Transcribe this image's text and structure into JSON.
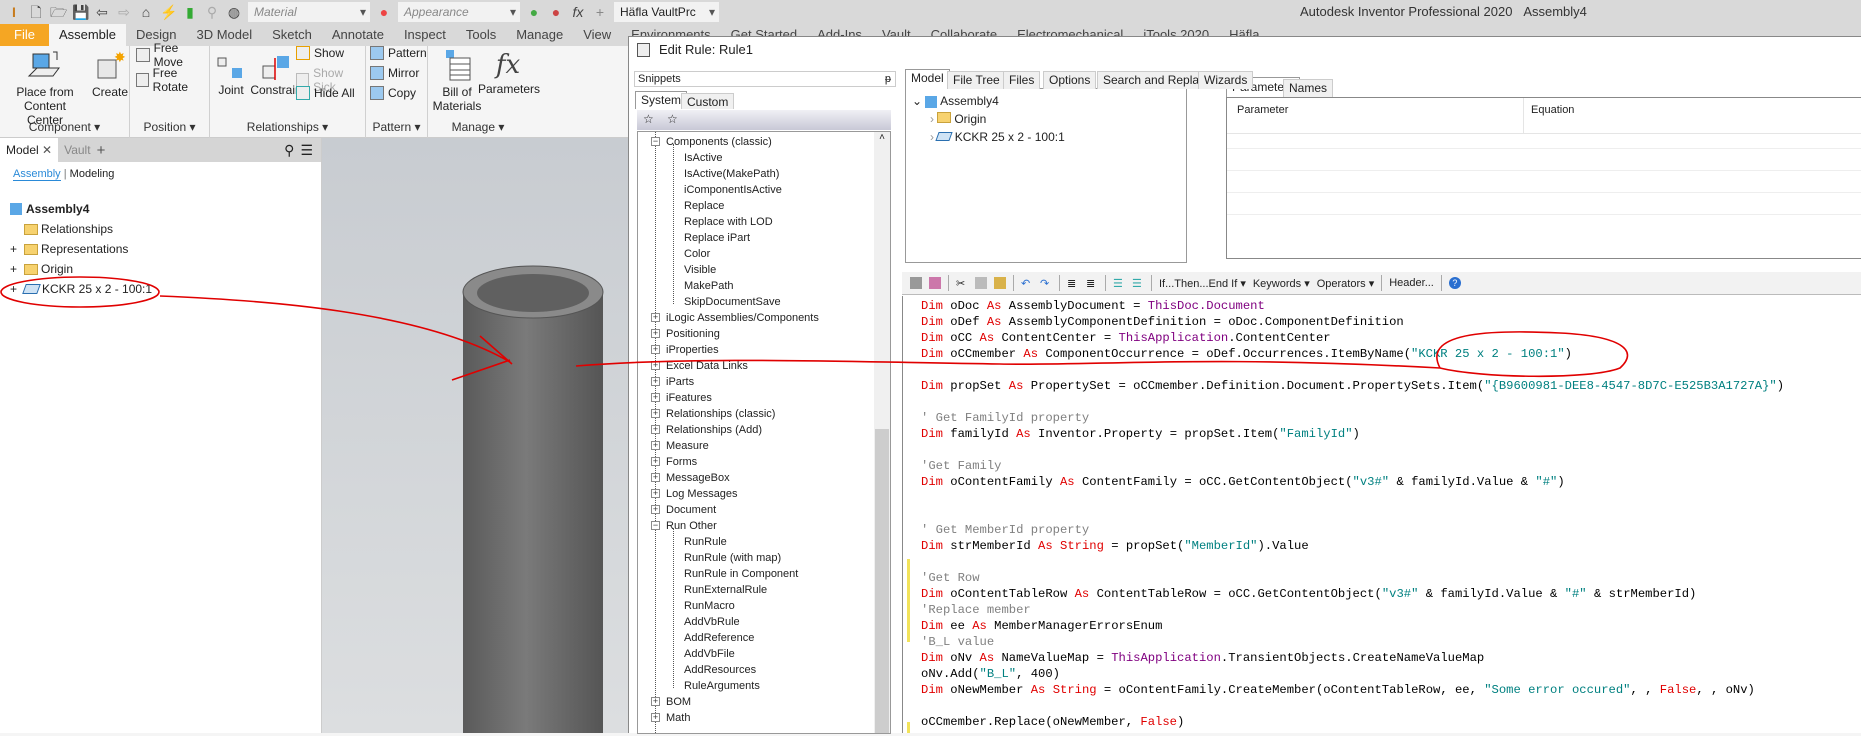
{
  "app": {
    "title": "Autodesk Inventor Professional 2020",
    "document": "Assembly4",
    "logo_text": "PRO"
  },
  "qat": {
    "material": "Material",
    "appearance": "Appearance",
    "vault": "Häfla VaultPrc"
  },
  "ribbon_tabs": [
    "File",
    "Assemble",
    "Design",
    "3D Model",
    "Sketch",
    "Annotate",
    "Inspect",
    "Tools",
    "Manage",
    "View",
    "Environments",
    "Get Started",
    "Add-Ins",
    "Vault",
    "Collaborate",
    "Electromechanical",
    "iTools 2020",
    "Häfla"
  ],
  "ribbon": {
    "component": {
      "label": "Component",
      "place": "Place from\nContent Center",
      "create": "Create"
    },
    "position": {
      "label": "Position",
      "free_move": "Free Move",
      "free_rotate": "Free Rotate"
    },
    "relationships": {
      "label": "Relationships",
      "joint": "Joint",
      "constrain": "Constrain",
      "show": "Show",
      "show_sick": "Show Sick",
      "hide_all": "Hide All"
    },
    "pattern": {
      "label": "Pattern",
      "pattern": "Pattern",
      "mirror": "Mirror",
      "copy": "Copy"
    },
    "manage": {
      "label": "Manage",
      "bom": "Bill of\nMaterials",
      "parameters": "Parameters"
    }
  },
  "browser": {
    "tab_model": "Model",
    "tab_vault": "Vault",
    "view_assembly": "Assembly",
    "view_modeling": "Modeling",
    "root": "Assembly4",
    "items": [
      "Relationships",
      "Representations",
      "Origin",
      "KCKR 25 x 2 - 100:1"
    ]
  },
  "dialog": {
    "title": "Edit Rule: Rule1",
    "snippets": {
      "header": "Snippets",
      "tabs": [
        "System",
        "Custom"
      ],
      "items": [
        {
          "label": "Components (classic)",
          "level": 0,
          "expanded": true
        },
        {
          "label": "IsActive",
          "level": 1
        },
        {
          "label": "IsActive(MakePath)",
          "level": 1
        },
        {
          "label": "iComponentIsActive",
          "level": 1
        },
        {
          "label": "Replace",
          "level": 1
        },
        {
          "label": "Replace with LOD",
          "level": 1
        },
        {
          "label": "Replace iPart",
          "level": 1
        },
        {
          "label": "Color",
          "level": 1
        },
        {
          "label": "Visible",
          "level": 1
        },
        {
          "label": "MakePath",
          "level": 1
        },
        {
          "label": "SkipDocumentSave",
          "level": 1
        },
        {
          "label": "iLogic Assemblies/Components",
          "level": 0
        },
        {
          "label": "Positioning",
          "level": 0
        },
        {
          "label": "iProperties",
          "level": 0
        },
        {
          "label": "Excel Data Links",
          "level": 0
        },
        {
          "label": "iParts",
          "level": 0
        },
        {
          "label": "iFeatures",
          "level": 0
        },
        {
          "label": "Relationships (classic)",
          "level": 0
        },
        {
          "label": "Relationships (Add)",
          "level": 0
        },
        {
          "label": "Measure",
          "level": 0
        },
        {
          "label": "Forms",
          "level": 0
        },
        {
          "label": "MessageBox",
          "level": 0
        },
        {
          "label": "Log Messages",
          "level": 0
        },
        {
          "label": "Document",
          "level": 0
        },
        {
          "label": "Run Other",
          "level": 0,
          "expanded": true
        },
        {
          "label": "RunRule",
          "level": 1
        },
        {
          "label": "RunRule (with map)",
          "level": 1
        },
        {
          "label": "RunRule in Component",
          "level": 1
        },
        {
          "label": "RunExternalRule",
          "level": 1
        },
        {
          "label": "RunMacro",
          "level": 1
        },
        {
          "label": "AddVbRule",
          "level": 1
        },
        {
          "label": "AddReference",
          "level": 1
        },
        {
          "label": "AddVbFile",
          "level": 1
        },
        {
          "label": "AddResources",
          "level": 1
        },
        {
          "label": "RuleArguments",
          "level": 1
        },
        {
          "label": "BOM",
          "level": 0
        },
        {
          "label": "Math",
          "level": 0
        }
      ]
    },
    "tabs": [
      "Model",
      "File Tree",
      "Files",
      "Options",
      "Search and Replace",
      "Wizards"
    ],
    "model_tree": [
      "Assembly4",
      "Origin",
      "KCKR 25 x 2 - 100:1"
    ],
    "param_tabs": [
      "Parameters",
      "Names"
    ],
    "param_columns": [
      "Parameter",
      "Equation"
    ],
    "toolbar": {
      "if_then": "If...Then...End If",
      "keywords": "Keywords",
      "operators": "Operators",
      "header": "Header..."
    },
    "code": [
      [
        [
          "k",
          "Dim"
        ],
        [
          "t",
          " oDoc "
        ],
        [
          "k",
          "As"
        ],
        [
          "t",
          " AssemblyDocument = "
        ],
        [
          "p",
          "ThisDoc.Document"
        ]
      ],
      [
        [
          "k",
          "Dim"
        ],
        [
          "t",
          " oDef "
        ],
        [
          "k",
          "As"
        ],
        [
          "t",
          " AssemblyComponentDefinition = oDoc.ComponentDefinition"
        ]
      ],
      [
        [
          "k",
          "Dim"
        ],
        [
          "t",
          " oCC "
        ],
        [
          "k",
          "As"
        ],
        [
          "t",
          " ContentCenter = "
        ],
        [
          "p",
          "ThisApplication"
        ],
        [
          "t",
          ".ContentCenter"
        ]
      ],
      [
        [
          "k",
          "Dim"
        ],
        [
          "t",
          " oCCmember "
        ],
        [
          "k",
          "As"
        ],
        [
          "t",
          " ComponentOccurrence = oDef.Occurrences.ItemByName("
        ],
        [
          "s",
          "\"KCKR 25 x 2 - 100:1\""
        ],
        [
          "t",
          ")"
        ]
      ],
      [],
      [
        [
          "k",
          "Dim"
        ],
        [
          "t",
          " propSet "
        ],
        [
          "k",
          "As"
        ],
        [
          "t",
          " PropertySet = oCCmember.Definition.Document.PropertySets.Item("
        ],
        [
          "s",
          "\"{B9600981-DEE8-4547-8D7C-E525B3A1727A}\""
        ],
        [
          "t",
          ")"
        ]
      ],
      [],
      [
        [
          "c",
          "' Get FamilyId property"
        ]
      ],
      [
        [
          "k",
          "Dim"
        ],
        [
          "t",
          " familyId "
        ],
        [
          "k",
          "As"
        ],
        [
          "t",
          " Inventor.Property = propSet.Item("
        ],
        [
          "s",
          "\"FamilyId\""
        ],
        [
          "t",
          ")"
        ]
      ],
      [],
      [
        [
          "c",
          "'Get Family"
        ]
      ],
      [
        [
          "k",
          "Dim"
        ],
        [
          "t",
          " oContentFamily "
        ],
        [
          "k",
          "As"
        ],
        [
          "t",
          " ContentFamily = oCC.GetContentObject("
        ],
        [
          "s",
          "\"v3#\""
        ],
        [
          "t",
          " & familyId.Value & "
        ],
        [
          "s",
          "\"#\""
        ],
        [
          "t",
          ")"
        ]
      ],
      [],
      [],
      [
        [
          "c",
          "' Get MemberId property"
        ]
      ],
      [
        [
          "k",
          "Dim"
        ],
        [
          "t",
          " strMemberId "
        ],
        [
          "k",
          "As"
        ],
        [
          "t",
          " "
        ],
        [
          "k",
          "String"
        ],
        [
          "t",
          " = propSet("
        ],
        [
          "s",
          "\"MemberId\""
        ],
        [
          "t",
          ").Value"
        ]
      ],
      [],
      [
        [
          "c",
          "'Get Row"
        ]
      ],
      [
        [
          "k",
          "Dim"
        ],
        [
          "t",
          " oContentTableRow "
        ],
        [
          "k",
          "As"
        ],
        [
          "t",
          " ContentTableRow = oCC.GetContentObject("
        ],
        [
          "s",
          "\"v3#\""
        ],
        [
          "t",
          " & familyId.Value & "
        ],
        [
          "s",
          "\"#\""
        ],
        [
          "t",
          " & strMemberId)"
        ]
      ],
      [
        [
          "c",
          "'Replace member"
        ]
      ],
      [
        [
          "k",
          "Dim"
        ],
        [
          "t",
          " ee "
        ],
        [
          "k",
          "As"
        ],
        [
          "t",
          " MemberManagerErrorsEnum"
        ]
      ],
      [
        [
          "c",
          "'B_L value"
        ]
      ],
      [
        [
          "k",
          "Dim"
        ],
        [
          "t",
          " oNv "
        ],
        [
          "k",
          "As"
        ],
        [
          "t",
          " NameValueMap = "
        ],
        [
          "p",
          "ThisApplication"
        ],
        [
          "t",
          ".TransientObjects.CreateNameValueMap"
        ]
      ],
      [
        [
          "t",
          "oNv.Add("
        ],
        [
          "s",
          "\"B_L\""
        ],
        [
          "t",
          ", 400)"
        ]
      ],
      [
        [
          "k",
          "Dim"
        ],
        [
          "t",
          " oNewMember "
        ],
        [
          "k",
          "As"
        ],
        [
          "t",
          " "
        ],
        [
          "k",
          "String"
        ],
        [
          "t",
          " = oContentFamily.CreateMember(oContentTableRow, ee, "
        ],
        [
          "s",
          "\"Some error occured\""
        ],
        [
          "t",
          ", , "
        ],
        [
          "k",
          "False"
        ],
        [
          "t",
          ", , oNv)"
        ]
      ],
      [],
      [
        [
          "t",
          "oCCmember.Replace(oNewMember, "
        ],
        [
          "k",
          "False"
        ],
        [
          "t",
          ")"
        ]
      ]
    ]
  },
  "colors": {
    "accent": "#f5a623",
    "keyword": "#e00000",
    "string": "#008080",
    "comment": "#808080",
    "object": "#800080",
    "annotation": "#e00000"
  }
}
